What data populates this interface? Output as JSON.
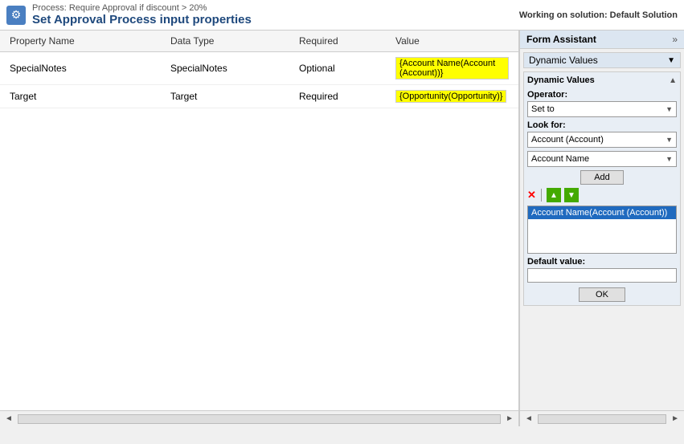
{
  "topBar": {
    "processLabel": "Process: Require Approval if discount > 20%",
    "pageTitle": "Set Approval Process input properties",
    "workingOnLabel": "Working on solution: Default Solution",
    "gearIcon": "⚙"
  },
  "table": {
    "headers": [
      "Property Name",
      "Data Type",
      "Required",
      "Value"
    ],
    "rows": [
      {
        "propertyName": "SpecialNotes",
        "dataType": "SpecialNotes",
        "required": "Optional",
        "value": "{Account Name(Account (Account))}"
      },
      {
        "propertyName": "Target",
        "dataType": "Target",
        "required": "Required",
        "value": "{Opportunity(Opportunity)}"
      }
    ]
  },
  "rightPanel": {
    "title": "Form Assistant",
    "doubleChevron": "»",
    "dynamicValuesLabel": "Dynamic Values",
    "dynamicValuesSectionTitle": "Dynamic Values",
    "operator": {
      "label": "Operator:",
      "value": "Set to",
      "arrow": "▼"
    },
    "lookFor": {
      "label": "Look for:",
      "value": "Account (Account)",
      "arrow": "▼"
    },
    "fieldSelect": {
      "value": "Account Name",
      "arrow": "▼"
    },
    "addButton": "Add",
    "icons": {
      "x": "✕",
      "up": "▲",
      "down": "▼"
    },
    "selectedItem": "Account Name(Account (Account))",
    "defaultValueLabel": "Default value:",
    "okButton": "OK"
  },
  "scrollbar": {
    "leftArrow": "◄",
    "rightArrow": "►"
  }
}
